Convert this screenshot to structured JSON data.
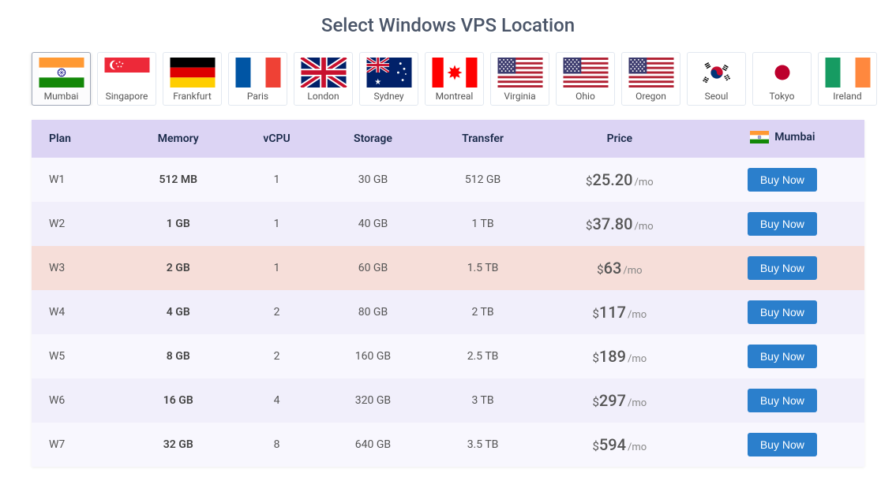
{
  "title": "Select Windows VPS Location",
  "selected_location": "Mumbai",
  "locations": [
    {
      "id": "mumbai",
      "label": "Mumbai",
      "flag": "in"
    },
    {
      "id": "singapore",
      "label": "Singapore",
      "flag": "sg"
    },
    {
      "id": "frankfurt",
      "label": "Frankfurt",
      "flag": "de"
    },
    {
      "id": "paris",
      "label": "Paris",
      "flag": "fr"
    },
    {
      "id": "london",
      "label": "London",
      "flag": "uk"
    },
    {
      "id": "sydney",
      "label": "Sydney",
      "flag": "au"
    },
    {
      "id": "montreal",
      "label": "Montreal",
      "flag": "ca"
    },
    {
      "id": "virginia",
      "label": "Virginia",
      "flag": "us"
    },
    {
      "id": "ohio",
      "label": "Ohio",
      "flag": "us"
    },
    {
      "id": "oregon",
      "label": "Oregon",
      "flag": "us"
    },
    {
      "id": "seoul",
      "label": "Seoul",
      "flag": "kr"
    },
    {
      "id": "tokyo",
      "label": "Tokyo",
      "flag": "jp"
    },
    {
      "id": "ireland",
      "label": "Ireland",
      "flag": "ie"
    }
  ],
  "table": {
    "headers": {
      "plan": "Plan",
      "memory": "Memory",
      "vcpu": "vCPU",
      "storage": "Storage",
      "transfer": "Transfer",
      "price": "Price",
      "location_flag": "in",
      "location_label": "Mumbai"
    },
    "rows": [
      {
        "plan": "W1",
        "memory": "512 MB",
        "vcpu": "1",
        "storage": "30 GB",
        "transfer": "512 GB",
        "price": "25.20",
        "currency": "$",
        "unit": "/mo",
        "highlight": false
      },
      {
        "plan": "W2",
        "memory": "1 GB",
        "vcpu": "1",
        "storage": "40 GB",
        "transfer": "1 TB",
        "price": "37.80",
        "currency": "$",
        "unit": "/mo",
        "highlight": false
      },
      {
        "plan": "W3",
        "memory": "2 GB",
        "vcpu": "1",
        "storage": "60 GB",
        "transfer": "1.5 TB",
        "price": "63",
        "currency": "$",
        "unit": "/mo",
        "highlight": true
      },
      {
        "plan": "W4",
        "memory": "4 GB",
        "vcpu": "2",
        "storage": "80 GB",
        "transfer": "2 TB",
        "price": "117",
        "currency": "$",
        "unit": "/mo",
        "highlight": false
      },
      {
        "plan": "W5",
        "memory": "8 GB",
        "vcpu": "2",
        "storage": "160 GB",
        "transfer": "2.5 TB",
        "price": "189",
        "currency": "$",
        "unit": "/mo",
        "highlight": false
      },
      {
        "plan": "W6",
        "memory": "16 GB",
        "vcpu": "4",
        "storage": "320 GB",
        "transfer": "3 TB",
        "price": "297",
        "currency": "$",
        "unit": "/mo",
        "highlight": false
      },
      {
        "plan": "W7",
        "memory": "32 GB",
        "vcpu": "8",
        "storage": "640 GB",
        "transfer": "3.5 TB",
        "price": "594",
        "currency": "$",
        "unit": "/mo",
        "highlight": false
      }
    ],
    "buy_label": "Buy Now"
  }
}
